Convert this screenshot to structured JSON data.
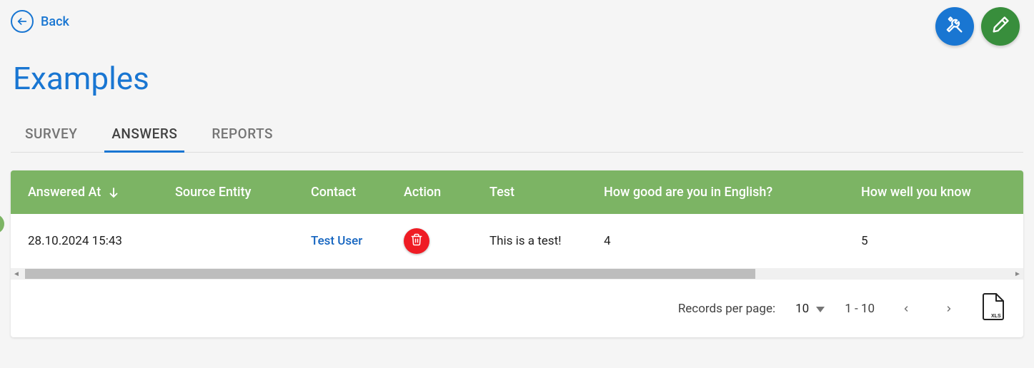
{
  "nav": {
    "back_label": "Back"
  },
  "page_title": "Examples",
  "tabs": [
    {
      "label": "SURVEY",
      "active": false
    },
    {
      "label": "ANSWERS",
      "active": true
    },
    {
      "label": "REPORTS",
      "active": false
    }
  ],
  "table": {
    "columns": [
      "Answered At",
      "Source Entity",
      "Contact",
      "Action",
      "Test",
      "How good are you in English?",
      "How well you know"
    ],
    "sort_column": "Answered At",
    "sort_direction": "desc",
    "rows": [
      {
        "answered_at": "28.10.2024 15:43",
        "source_entity": "",
        "contact": "Test User",
        "test": "This is a test!",
        "english": "4",
        "know": "5"
      }
    ]
  },
  "pagination": {
    "records_per_page_label": "Records per page:",
    "per_page_value": "10",
    "range_display": "1 - 10",
    "export_label": "XLS"
  }
}
